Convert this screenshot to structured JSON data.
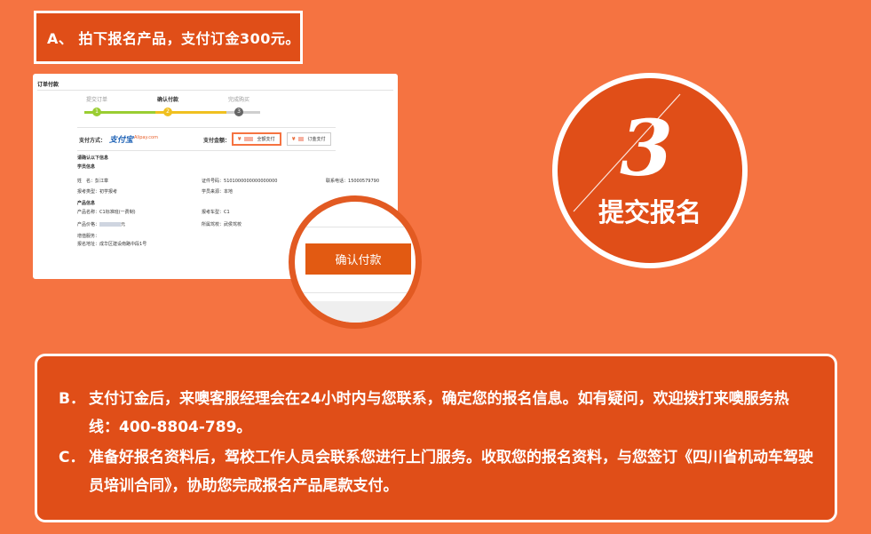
{
  "step_a": {
    "text": "A、 拍下报名产品，支付订金300元。"
  },
  "order_panel": {
    "header": "订单付款",
    "steps": [
      {
        "label": "提交订单",
        "num": "1",
        "color": "#9acd32"
      },
      {
        "label": "确认付款",
        "num": "2",
        "color": "#f0c020"
      },
      {
        "label": "完成购买",
        "num": "3",
        "color": "#666666"
      }
    ],
    "pay_method_label": "支付方式：",
    "alipay_logo": "支付宝",
    "alipay_domain": "Alipay.com",
    "pay_amount_label": "支付金额：",
    "option_full": "全额支付",
    "option_deposit": "订金支付",
    "yen": "¥",
    "confirm_info": "请确认以下信息",
    "student_section": "学员信息",
    "name_label": "姓　名：",
    "name_value": "彭江章",
    "id_label": "证件号码：",
    "id_value": "5101000000000000000",
    "phone_label": "联系电话：",
    "phone_value": "15000579790",
    "type_label": "报考类型：",
    "type_value": "初学报考",
    "source_label": "学员来源：",
    "source_value": "本地",
    "product_section": "产品信息",
    "product_name_label": "产品名称：",
    "product_name_value": "C1标准班(一费制)",
    "car_type_label": "报考车型：",
    "car_type_value": "C1",
    "price_label": "产品价格：",
    "price_value": "元",
    "school_label": "所属驾校：",
    "school_value": "武侯驾校",
    "gift_label": "增值服务：",
    "address_label": "报名地址：",
    "address_value": "成华区建设南路中段1号"
  },
  "confirm_button": "确认付款",
  "step_circle": {
    "number": "3",
    "title": "提交报名"
  },
  "info_box": {
    "b_mark": "B．",
    "b_text": "支付订金后，来噢客服经理会在24小时内与您联系，确定您的报名信息。如有疑问，欢迎拨打来噢服务热线：400-8804-789。",
    "c_mark": "C．",
    "c_text": "准备好报名资料后，驾校工作人员会联系您进行上门服务。收取您的报名资料，与您签订《四川省机动车驾驶员培训合同》，协助您完成报名产品尾款支付。"
  },
  "colors": {
    "background": "#f57341",
    "panel_dark": "#e04e18",
    "button": "#e25a12",
    "white": "#ffffff"
  }
}
